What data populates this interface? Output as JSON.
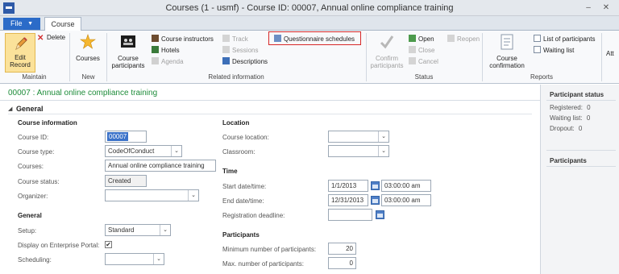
{
  "window": {
    "title": "Courses (1 - usmf) - Course ID: 00007, Annual online compliance training",
    "minimize": "–",
    "close": "✕"
  },
  "tabs": {
    "file": "File",
    "file_caret": "▼",
    "course": "Course"
  },
  "ribbon": {
    "maintain": {
      "label": "Maintain",
      "edit": "Edit Record",
      "delete": "Delete"
    },
    "new": {
      "label": "New",
      "courses": "Courses"
    },
    "related": {
      "label": "Related information",
      "course_participants": "Course participants",
      "course_instructors": "Course instructors",
      "hotels": "Hotels",
      "agenda": "Agenda",
      "track": "Track",
      "sessions": "Sessions",
      "descriptions": "Descriptions",
      "questionnaire_schedules": "Questionnaire schedules"
    },
    "status": {
      "label": "Status",
      "confirm_participants": "Confirm participants",
      "open": "Open",
      "close": "Close",
      "cancel": "Cancel",
      "reopen": "Reopen"
    },
    "reports": {
      "label": "Reports",
      "course_confirmation": "Course confirmation",
      "list_of_participants": "List of participants",
      "waiting_list": "Waiting list"
    },
    "overflow": "Att"
  },
  "form": {
    "title": "00007 : Annual online compliance training",
    "general_section": "General",
    "expander": "◢",
    "course_information": {
      "heading": "Course information",
      "course_id_label": "Course ID:",
      "course_id": "00007",
      "course_type_label": "Course type:",
      "course_type": "CodeOfConduct",
      "courses_label": "Courses:",
      "courses": "Annual online compliance training",
      "course_status_label": "Course status:",
      "course_status": "Created",
      "organizer_label": "Organizer:",
      "organizer": ""
    },
    "general": {
      "heading": "General",
      "setup_label": "Setup:",
      "setup": "Standard",
      "portal_label": "Display on Enterprise Portal:",
      "portal_checked": "✔",
      "scheduling_label": "Scheduling:",
      "scheduling": ""
    },
    "location": {
      "heading": "Location",
      "course_location_label": "Course location:",
      "course_location": "",
      "classroom_label": "Classroom:",
      "classroom": ""
    },
    "time": {
      "heading": "Time",
      "start_label": "Start date/time:",
      "start_date": "1/1/2013",
      "start_time": "03:00:00 am",
      "end_label": "End date/time:",
      "end_date": "12/31/2013",
      "end_time": "03:00:00 am",
      "deadline_label": "Registration deadline:",
      "deadline": ""
    },
    "participants": {
      "heading": "Participants",
      "min_label": "Minimum number of participants:",
      "min": "20",
      "max_label": "Max. number of participants:",
      "max": "0"
    }
  },
  "right_panel": {
    "status_heading": "Participant status",
    "registered_label": "Registered:",
    "registered": "0",
    "waiting_label": "Waiting list:",
    "waiting": "0",
    "dropout_label": "Dropout:",
    "dropout": "0",
    "participants_heading": "Participants"
  },
  "dropdown_glyph": "⌄",
  "colors": {
    "file_tab": "#2b6bc8",
    "form_title": "#1e8c3a",
    "highlight": "#d62828"
  }
}
